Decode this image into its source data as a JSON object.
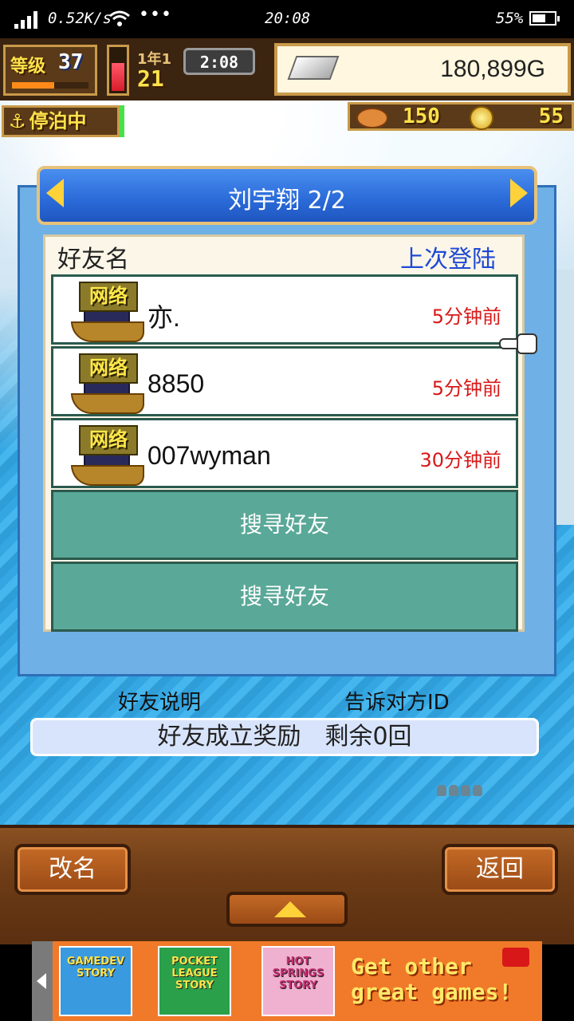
{
  "status_bar": {
    "net_speed": "0.52K/s",
    "time": "20:08",
    "battery": "55%"
  },
  "hud": {
    "level_label": "等级",
    "level": "37",
    "era": "1年1",
    "day": "21",
    "clock": "2:08",
    "money": "180,899G",
    "status": "停泊中",
    "resource_1": "150",
    "resource_2": "55"
  },
  "panel": {
    "title": "刘宇翔 2/2",
    "col_name": "好友名",
    "col_last_login": "上次登陆",
    "friends": [
      {
        "badge": "网络",
        "name": "亦.",
        "last_login": "5分钟前"
      },
      {
        "badge": "网络",
        "name": "8850",
        "last_login": "5分钟前"
      },
      {
        "badge": "网络",
        "name": "007wyman",
        "last_login": "30分钟前"
      }
    ],
    "search_buttons": [
      "搜寻好友",
      "搜寻好友"
    ],
    "link_explain": "好友说明",
    "link_tell_id": "告诉对方ID",
    "reward": "好友成立奖励　剩余0回"
  },
  "bottom": {
    "rename": "改名",
    "back": "返回"
  },
  "ad": {
    "tiles": [
      "GAMEDEV STORY",
      "POCKET LEAGUE STORY",
      "HOT SPRINGS STORY"
    ],
    "text": "Get other great games!"
  },
  "colors": {
    "sea": "#34a7e3",
    "header_blue": "#2a6ad8",
    "search_green": "#5aa898",
    "time_red": "#d81818",
    "login_blue": "#1f49d6"
  }
}
